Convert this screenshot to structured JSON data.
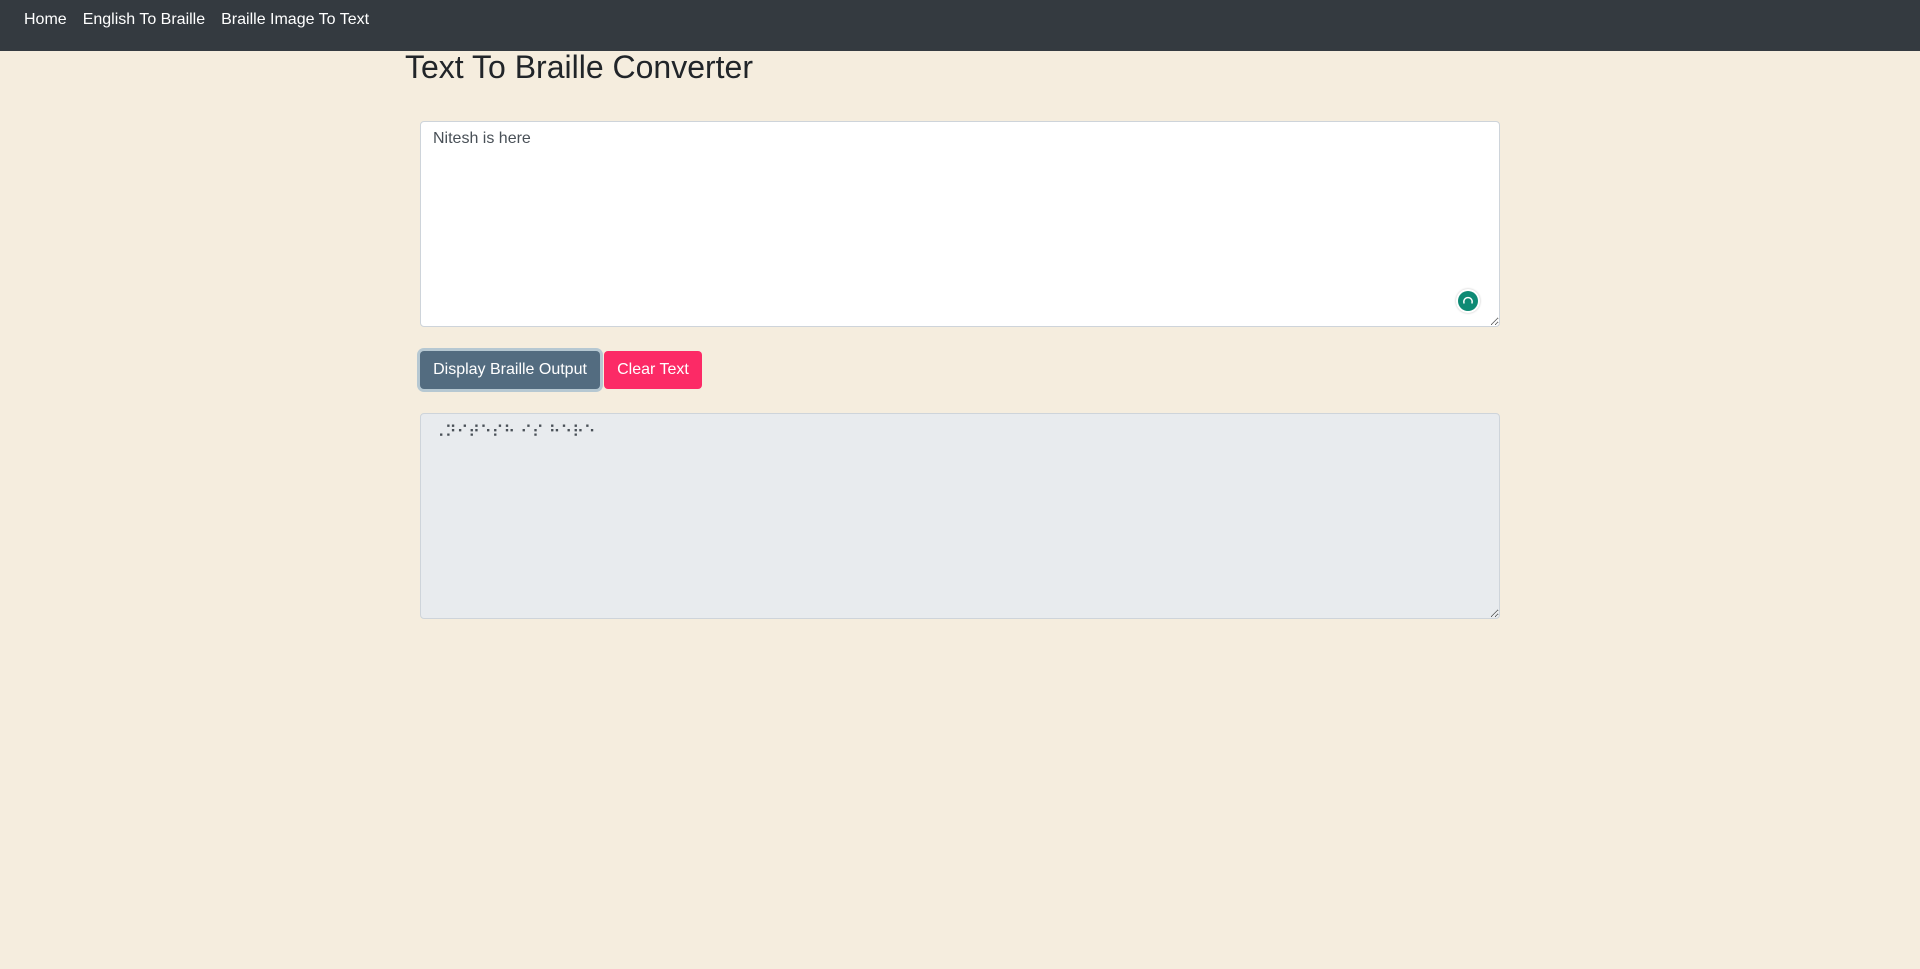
{
  "navbar": {
    "links": [
      {
        "label": "Home"
      },
      {
        "label": "English To Braille"
      },
      {
        "label": "Braille Image To Text"
      }
    ]
  },
  "page": {
    "title": "Text To Braille Converter"
  },
  "input": {
    "value": "Nitesh is here"
  },
  "buttons": {
    "display_label": "Display Braille Output",
    "clear_label": "Clear Text"
  },
  "output": {
    "value": "⠠⠝⠊⠞⠑⠎⠓ ⠊⠎ ⠓⠑⠗⠑"
  },
  "colors": {
    "navbar_bg": "#343a40",
    "page_bg": "#f5edde",
    "display_button": "#536c80",
    "clear_button": "#fc2a66",
    "grammar_badge": "#0e8a74"
  },
  "icons": {
    "grammar_badge": "grammar-check-icon"
  }
}
